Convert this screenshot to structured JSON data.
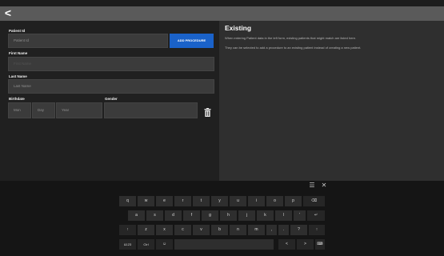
{
  "header": {
    "back_glyph": "<"
  },
  "form": {
    "patient_id": {
      "label": "Patient Id",
      "placeholder": "Patient Id"
    },
    "add_procedure_label": "ADD PROCEDURE",
    "first_name": {
      "label": "First Name",
      "placeholder": "First Name"
    },
    "last_name": {
      "label": "Last Name",
      "placeholder": "Last Name"
    },
    "birthdate": {
      "label": "Birthdate",
      "month_placeholder": "Mon",
      "day_placeholder": "Day",
      "year_placeholder": "Year"
    },
    "gender": {
      "label": "Gender",
      "value": ""
    },
    "delete_icon": "trash-icon"
  },
  "existing": {
    "title": "Existing",
    "lines": [
      "When entering Patient data in the left form, existing patients that might match are listed here.",
      "They can be selected to add a procedure to an existing patient instead of creating a new patient."
    ]
  },
  "keyboard": {
    "controls": {
      "layout_glyph": "☰",
      "close_glyph": "✕"
    },
    "row1": [
      "q",
      "w",
      "e",
      "r",
      "t",
      "y",
      "u",
      "i",
      "o",
      "p",
      "⌫"
    ],
    "row2": [
      "a",
      "s",
      "d",
      "f",
      "g",
      "h",
      "j",
      "k",
      "l",
      "'",
      "↵"
    ],
    "row3": [
      "↑",
      "z",
      "x",
      "c",
      "v",
      "b",
      "n",
      "m",
      ",",
      ".",
      "?",
      "↑"
    ],
    "row4": {
      "symbols": "&123",
      "ctrl": "Ctrl",
      "emoji": "☺",
      "space": "",
      "left": "<",
      "right": ">",
      "keyboard": "⌨"
    }
  },
  "colors": {
    "accent": "#1a62c9",
    "topbar": "#5a5a5a",
    "panel_right": "#2f2f2f",
    "panel_left": "#202020"
  }
}
